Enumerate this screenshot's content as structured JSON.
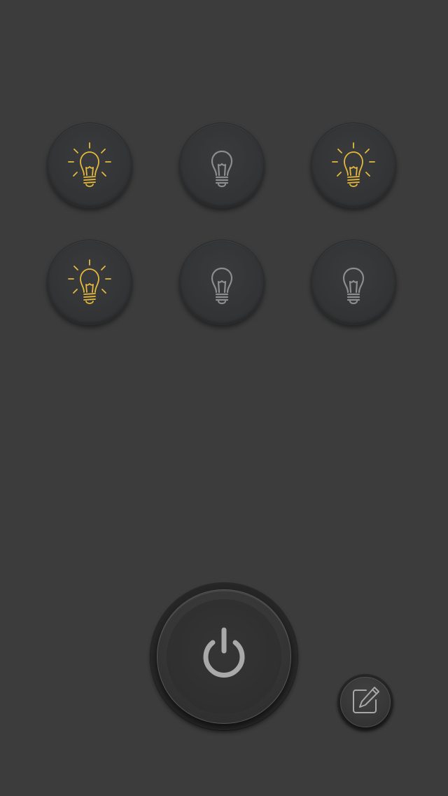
{
  "colors": {
    "background": "#3c3c3c",
    "bulb_on": "#e6b93c",
    "bulb_off": "#8d8d8d",
    "power_icon": "#a9a9a9"
  },
  "lights": [
    {
      "state": "on",
      "icon": "lightbulb-on-icon"
    },
    {
      "state": "off",
      "icon": "lightbulb-off-icon"
    },
    {
      "state": "on",
      "icon": "lightbulb-on-icon"
    },
    {
      "state": "on",
      "icon": "lightbulb-on-icon"
    },
    {
      "state": "off",
      "icon": "lightbulb-off-icon"
    },
    {
      "state": "off",
      "icon": "lightbulb-off-icon"
    }
  ],
  "controls": {
    "power": {
      "icon": "power-icon"
    },
    "edit": {
      "icon": "edit-pencil-icon"
    }
  }
}
